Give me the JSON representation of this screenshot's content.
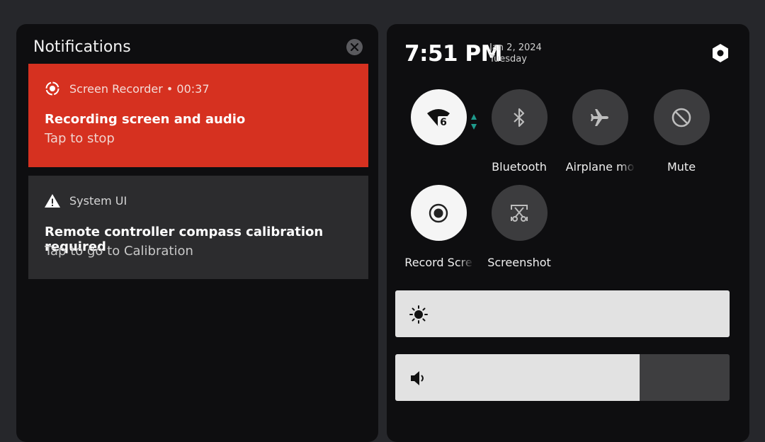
{
  "notifications": {
    "header": "Notifications",
    "items": [
      {
        "app": "Screen Recorder • 00:37",
        "title": "Recording screen and audio",
        "subtitle": "Tap to stop",
        "icon": "record-icon",
        "color": "#d63120"
      },
      {
        "app": "System UI",
        "title": "Remote controller compass calibration required",
        "subtitle": "Tap to go to Calibration",
        "icon": "warning-icon",
        "color": "#2c2c2e"
      }
    ]
  },
  "quick_settings": {
    "time": "7:51 PM",
    "date": "Jan 2, 2024",
    "weekday": "Tuesday",
    "tiles": [
      {
        "label": "",
        "icon": "wifi-icon",
        "active": true
      },
      {
        "label": "Bluetooth",
        "icon": "bluetooth-icon",
        "active": false
      },
      {
        "label": "Airplane mo",
        "icon": "airplane-icon",
        "active": false
      },
      {
        "label": "Mute",
        "icon": "mute-icon",
        "active": false
      },
      {
        "label": "Record Scre",
        "icon": "record-screen-icon",
        "active": true
      },
      {
        "label": "Screenshot",
        "icon": "screenshot-icon",
        "active": false
      }
    ],
    "sliders": {
      "brightness": {
        "icon": "brightness-icon",
        "level": 1.0
      },
      "volume": {
        "icon": "volume-icon",
        "level": 0.73
      }
    }
  },
  "colors": {
    "accent_red": "#d63120",
    "active_tile": "#f5f5f5",
    "inactive_tile": "#3c3c3e",
    "wifi_arrow": "#1e9a8c"
  }
}
